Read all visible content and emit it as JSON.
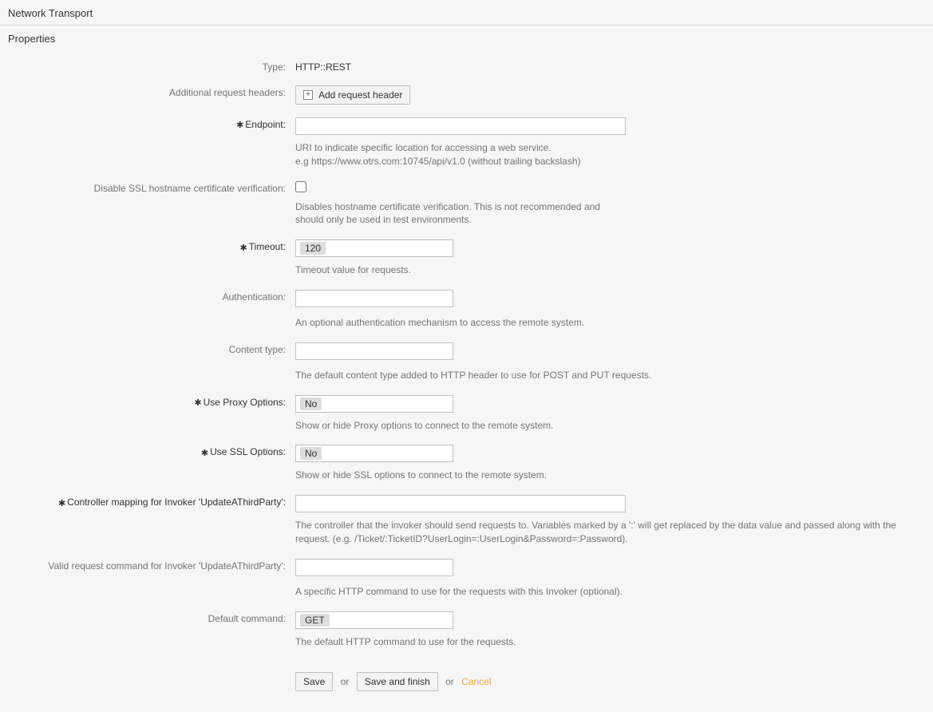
{
  "header": {
    "title": "Network Transport"
  },
  "panel": {
    "title": "Properties"
  },
  "fields": {
    "type": {
      "label": "Type:",
      "value": "HTTP::REST"
    },
    "headers": {
      "label": "Additional request headers:",
      "button": "Add request header"
    },
    "endpoint": {
      "label": "Endpoint:",
      "value": "",
      "hint1": "URI to indicate specific location for accessing a web service.",
      "hint2": "e.g https://www.otrs.com:10745/api/v1.0 (without trailing backslash)"
    },
    "ssl_disable": {
      "label": "Disable SSL hostname certificate verification:",
      "hint": "Disables hostname certificate verification. This is not recommended and should only be used in test environments."
    },
    "timeout": {
      "label": "Timeout:",
      "value": "120",
      "hint": "Timeout value for requests."
    },
    "auth": {
      "label": "Authentication:",
      "value": "",
      "hint": "An optional authentication mechanism to access the remote system."
    },
    "content_type": {
      "label": "Content type:",
      "value": "",
      "hint": "The default content type added to HTTP header to use for POST and PUT requests."
    },
    "proxy": {
      "label": "Use Proxy Options:",
      "value": "No",
      "hint": "Show or hide Proxy options to connect to the remote system."
    },
    "ssl": {
      "label": "Use SSL Options:",
      "value": "No",
      "hint": "Show or hide SSL options to connect to the remote system."
    },
    "controller": {
      "label": "Controller mapping for Invoker 'UpdateAThirdParty':",
      "value": "",
      "hint": "The controller that the invoker should send requests to. Variables marked by a ':' will get replaced by the data value and passed along with the request. (e.g. /Ticket/:TicketID?UserLogin=:UserLogin&Password=:Password)."
    },
    "valid_cmd": {
      "label": "Valid request command for Invoker 'UpdateAThirdParty':",
      "value": "",
      "hint": "A specific HTTP command to use for the requests with this Invoker (optional)."
    },
    "default_cmd": {
      "label": "Default command:",
      "value": "GET",
      "hint": "The default HTTP command to use for the requests."
    }
  },
  "actions": {
    "save": "Save",
    "save_finish": "Save and finish",
    "or": "or",
    "cancel": "Cancel"
  }
}
